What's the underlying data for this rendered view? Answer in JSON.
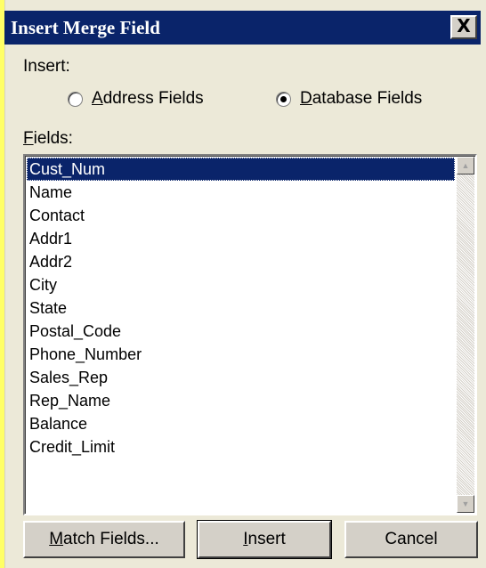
{
  "window": {
    "title": "Insert Merge Field",
    "close_label": "X"
  },
  "insert": {
    "label": "Insert:",
    "address_fields": {
      "access_key": "A",
      "rest": "ddress Fields",
      "selected": false
    },
    "database_fields": {
      "access_key": "D",
      "rest": "atabase Fields",
      "selected": true
    }
  },
  "fields": {
    "label_access_key": "F",
    "label_rest": "ields:",
    "items": [
      "Cust_Num",
      "Name",
      "Contact",
      "Addr1",
      "Addr2",
      "City",
      "State",
      "Postal_Code",
      "Phone_Number",
      "Sales_Rep",
      "Rep_Name",
      "Balance",
      "Credit_Limit"
    ],
    "selected_index": 0,
    "scroll_up_icon": "up-arrow",
    "scroll_down_icon": "down-arrow"
  },
  "buttons": {
    "match_fields": {
      "access_key": "M",
      "rest": "atch Fields..."
    },
    "insert": {
      "access_key": "I",
      "rest": "nsert"
    },
    "cancel": {
      "label": "Cancel"
    }
  },
  "colors": {
    "background": "#ffff66",
    "titlebar": "#0a246a",
    "selection": "#0a246a",
    "dialog_face": "#ece9d8"
  }
}
